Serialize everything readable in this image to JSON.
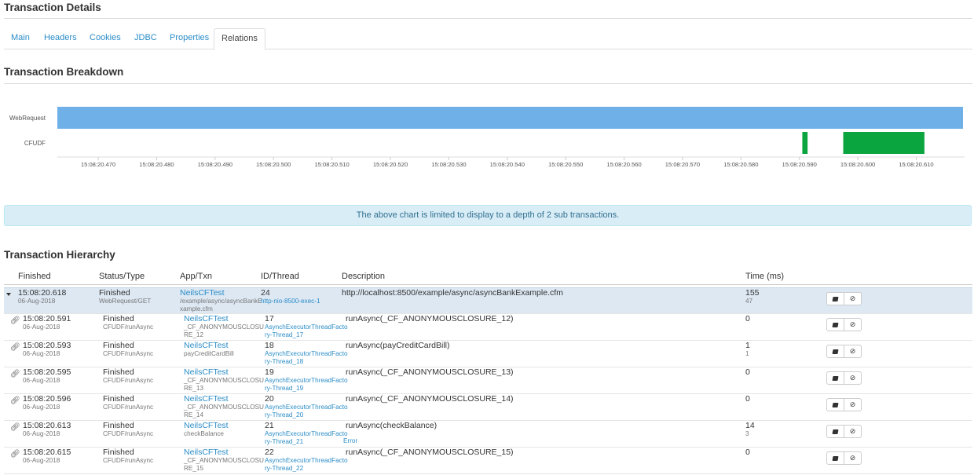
{
  "page": {
    "title": "Transaction Details",
    "tabs": [
      "Main",
      "Headers",
      "Cookies",
      "JDBC",
      "Properties",
      "Relations"
    ],
    "active_tab": "Relations",
    "breakdown_title": "Transaction Breakdown",
    "hierarchy_title": "Transaction Hierarchy",
    "notice": "The above chart is limited to display to a depth of 2 sub transactions."
  },
  "chart_data": {
    "type": "bar",
    "orientation": "horizontal-timeline",
    "categories": [
      "WebRequest",
      "CFUDF"
    ],
    "x_ticks": [
      "15:08:20.470",
      "15:08:20.480",
      "15:08:20.490",
      "15:08:20.500",
      "15:08:20.510",
      "15:08:20.520",
      "15:08:20.530",
      "15:08:20.540",
      "15:08:20.550",
      "15:08:20.560",
      "15:08:20.570",
      "15:08:20.580",
      "15:08:20.590",
      "15:08:20.600",
      "15:08:20.610"
    ],
    "x_range_ms": [
      20.463,
      20.618
    ],
    "spans": [
      {
        "row": "WebRequest",
        "start": 20.463,
        "end": 20.618,
        "color": "#6fb0e8"
      },
      {
        "row": "CFUDF",
        "start": 20.5905,
        "end": 20.5914,
        "color": "#0ba540"
      },
      {
        "row": "CFUDF",
        "start": 20.5975,
        "end": 20.6114,
        "color": "#0ba540"
      }
    ]
  },
  "table": {
    "headers": [
      "Finished",
      "Status/Type",
      "App/Txn",
      "ID/Thread",
      "Description",
      "Time (ms)"
    ],
    "rows": [
      {
        "time": "15:08:20.618",
        "date": "06-Aug-2018",
        "status": "Finished",
        "type": "WebRequest/GET",
        "app": "NeilsCFTest",
        "txn_lines": [
          "/example/async/asyncBankE",
          "xample.cfm"
        ],
        "id": "24",
        "thread_lines": [
          "http-nio-8500-exec-1"
        ],
        "desc": "http://localhost:8500/example/async/asyncBankExample.cfm",
        "error": "",
        "ms": "155",
        "ms2": "47",
        "top": true
      },
      {
        "time": "15:08:20.591",
        "date": "06-Aug-2018",
        "status": "Finished",
        "type": "CFUDF/runAsync",
        "app": "NeilsCFTest",
        "txn_lines": [
          "_CF_ANONYMOUSCLOSU",
          "RE_12"
        ],
        "id": "17",
        "thread_lines": [
          "AsynchExecutorThreadFacto",
          "ry-Thread_17"
        ],
        "desc": "runAsync(_CF_ANONYMOUSCLOSURE_12)",
        "error": "",
        "ms": "0",
        "ms2": ""
      },
      {
        "time": "15:08:20.593",
        "date": "06-Aug-2018",
        "status": "Finished",
        "type": "CFUDF/runAsync",
        "app": "NeilsCFTest",
        "txn_lines": [
          "payCreditCardBill"
        ],
        "id": "18",
        "thread_lines": [
          "AsynchExecutorThreadFacto",
          "ry-Thread_18"
        ],
        "desc": "runAsync(payCreditCardBill)",
        "error": "",
        "ms": "1",
        "ms2": "1"
      },
      {
        "time": "15:08:20.595",
        "date": "06-Aug-2018",
        "status": "Finished",
        "type": "CFUDF/runAsync",
        "app": "NeilsCFTest",
        "txn_lines": [
          "_CF_ANONYMOUSCLOSU",
          "RE_13"
        ],
        "id": "19",
        "thread_lines": [
          "AsynchExecutorThreadFacto",
          "ry-Thread_19"
        ],
        "desc": "runAsync(_CF_ANONYMOUSCLOSURE_13)",
        "error": "",
        "ms": "0",
        "ms2": ""
      },
      {
        "time": "15:08:20.596",
        "date": "06-Aug-2018",
        "status": "Finished",
        "type": "CFUDF/runAsync",
        "app": "NeilsCFTest",
        "txn_lines": [
          "_CF_ANONYMOUSCLOSU",
          "RE_14"
        ],
        "id": "20",
        "thread_lines": [
          "AsynchExecutorThreadFacto",
          "ry-Thread_20"
        ],
        "desc": "runAsync(_CF_ANONYMOUSCLOSURE_14)",
        "error": "",
        "ms": "0",
        "ms2": ""
      },
      {
        "time": "15:08:20.613",
        "date": "06-Aug-2018",
        "status": "Finished",
        "type": "CFUDF/runAsync",
        "app": "NeilsCFTest",
        "txn_lines": [
          "checkBalance"
        ],
        "id": "21",
        "thread_lines": [
          "AsynchExecutorThreadFacto",
          "ry-Thread_21"
        ],
        "desc": "runAsync(checkBalance)",
        "error": "Error",
        "ms": "14",
        "ms2": "3"
      },
      {
        "time": "15:08:20.615",
        "date": "06-Aug-2018",
        "status": "Finished",
        "type": "CFUDF/runAsync",
        "app": "NeilsCFTest",
        "txn_lines": [
          "_CF_ANONYMOUSCLOSU",
          "RE_15"
        ],
        "id": "22",
        "thread_lines": [
          "AsynchExecutorThreadFacto",
          "ry-Thread_22"
        ],
        "desc": "runAsync(_CF_ANONYMOUSCLOSURE_15)",
        "error": "",
        "ms": "0",
        "ms2": ""
      }
    ]
  },
  "icons": {
    "details": "book-icon",
    "ignore": "ban-icon",
    "relation": "link-icon",
    "expand": "caret-down-icon"
  }
}
